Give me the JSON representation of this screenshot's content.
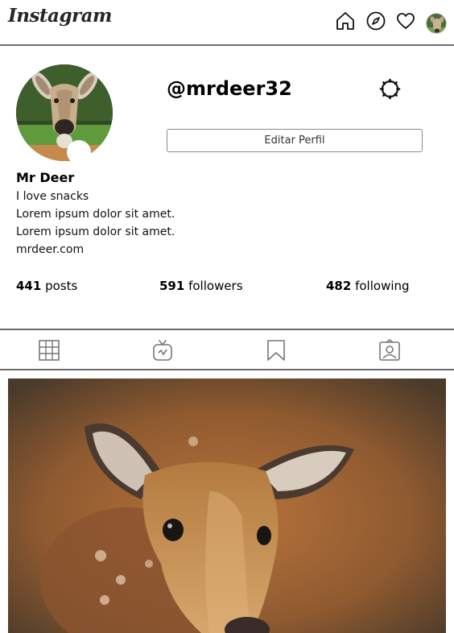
{
  "app": {
    "logo_text": "Instagram"
  },
  "nav": {
    "icons": [
      "home-icon",
      "explore-compass-icon",
      "heart-icon",
      "profile-avatar"
    ]
  },
  "profile": {
    "username": "@mrdeer32",
    "edit_button_label": "Editar Perfil",
    "full_name": "Mr Deer",
    "bio": [
      "I love snacks",
      "Lorem ipsum dolor sit amet.",
      "Lorem ipsum dolor sit amet."
    ],
    "website": "mrdeer.com"
  },
  "stats": {
    "posts": {
      "count": "441",
      "label": "posts"
    },
    "followers": {
      "count": "591",
      "label": "followers"
    },
    "following": {
      "count": "482",
      "label": "following"
    }
  },
  "tabs": [
    "grid-icon",
    "igtv-icon",
    "saved-bookmark-icon",
    "tagged-icon"
  ],
  "colors": {
    "border": "#6d6d6d",
    "text": "#000000",
    "button_border": "#8a8a8a"
  }
}
